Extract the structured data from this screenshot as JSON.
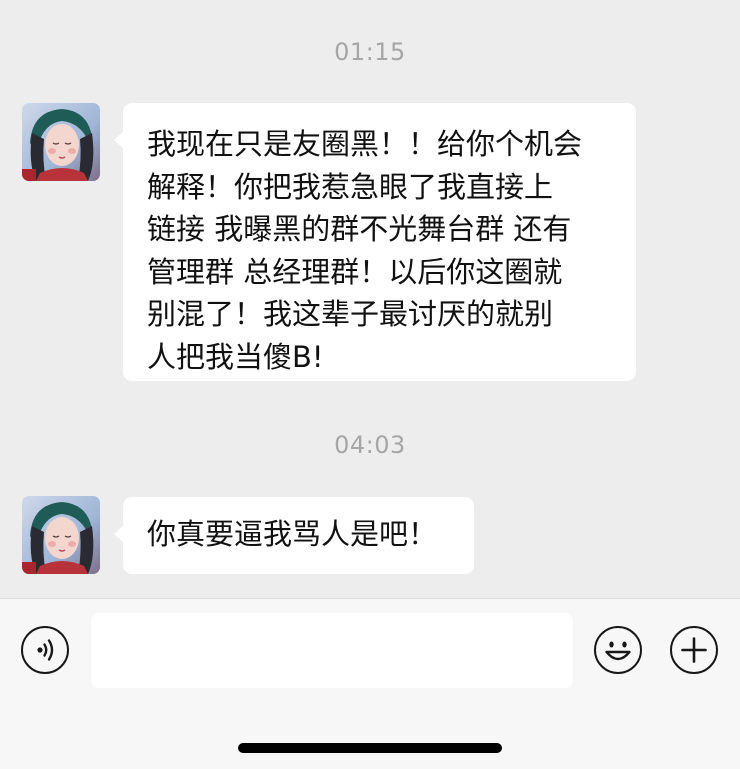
{
  "messages": [
    {
      "time": "01:15",
      "lines": [
        "我现在只是友圈黑！！给你个机会",
        "解释！你把我惹急眼了我直接上",
        "链接 我曝黑的群不光舞台群 还有",
        "管理群 总经理群！以后你这圈就",
        "别混了！我这辈子最讨厌的就别",
        "人把我当傻B!"
      ]
    },
    {
      "time": "04:03",
      "lines": [
        "你真要逼我骂人是吧！"
      ]
    }
  ],
  "icons": {
    "voice": "voice-input-icon",
    "emoji": "emoji-icon",
    "plus": "plus-icon",
    "avatar": "contact-avatar"
  },
  "colors": {
    "background": "#ededed",
    "bubble": "#ffffff",
    "timestamp": "#a6a6a6",
    "text": "#111111"
  }
}
